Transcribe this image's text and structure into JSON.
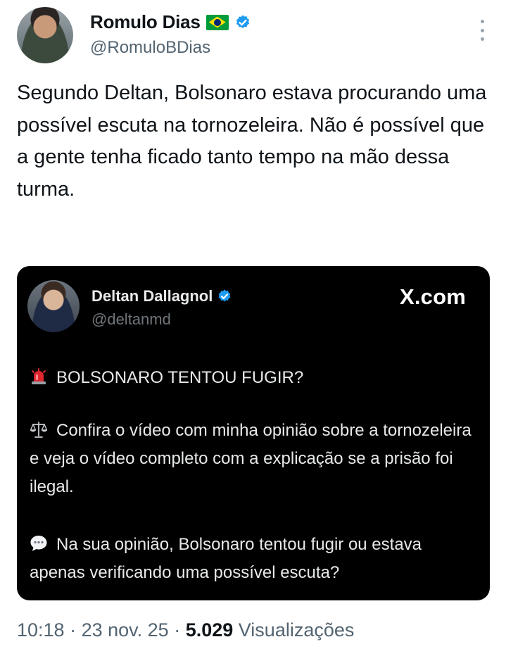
{
  "author": {
    "name": "Romulo Dias",
    "handle": "@RomuloBDias"
  },
  "tweet": {
    "text": "Segundo Deltan, Bolsonaro estava procurando uma possível escuta na tornozeleira. Não é possível que a gente tenha ficado tanto tempo na mão dessa turma."
  },
  "quoted": {
    "name": "Deltan Dallagnol",
    "handle": "@deltanmd",
    "source": "X.com",
    "paragraph1": "BOLSONARO TENTOU FUGIR?",
    "paragraph2": "Confira o vídeo com minha opinião sobre a tornozeleira e veja o vídeo completo com a explicação se a prisão foi ilegal.",
    "paragraph3": "Na sua opinião, Bolsonaro tentou fugir ou estava apenas verificando uma possível escuta?"
  },
  "meta": {
    "time": "10:18",
    "sep1": " · ",
    "date": "23 nov. 25",
    "sep2": " · ",
    "views_count": "5.029",
    "views_label": "Visualizações"
  },
  "colors": {
    "verified": "#1d9bf0",
    "secondary_text": "#536471",
    "card_background": "#000000"
  },
  "icons": [
    "brazil-flag-icon",
    "verified-icon",
    "more-icon",
    "siren-icon",
    "scales-icon",
    "speech-bubble-icon"
  ]
}
